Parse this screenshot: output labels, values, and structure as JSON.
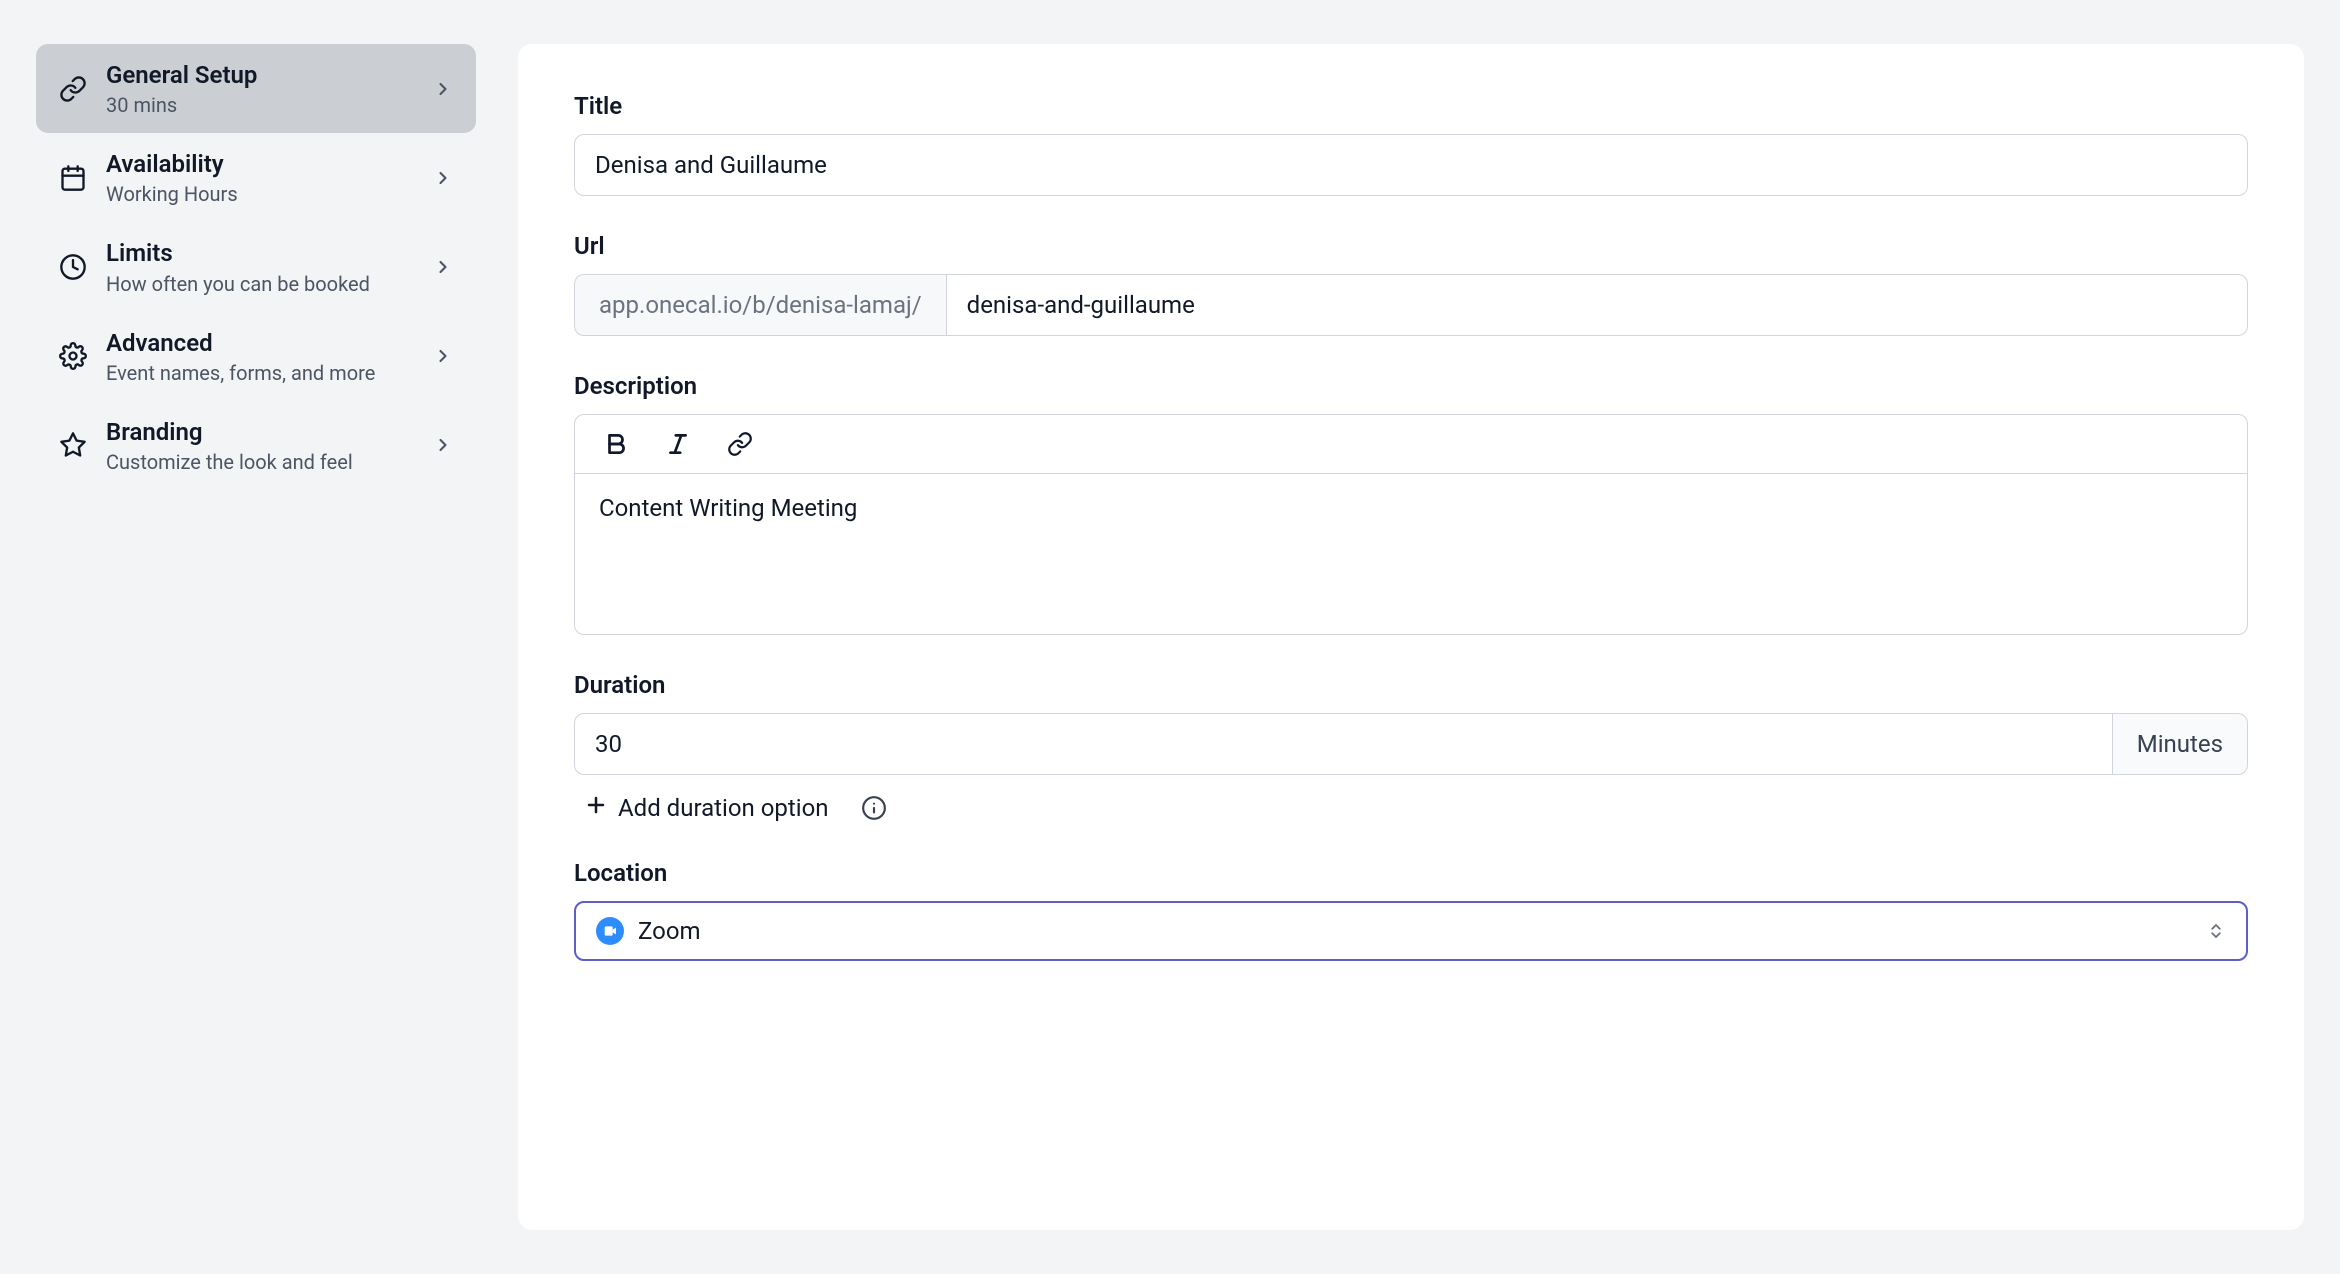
{
  "sidebar": {
    "items": [
      {
        "title": "General Setup",
        "subtitle": "30 mins"
      },
      {
        "title": "Availability",
        "subtitle": "Working Hours"
      },
      {
        "title": "Limits",
        "subtitle": "How often you can be booked"
      },
      {
        "title": "Advanced",
        "subtitle": "Event names, forms, and more"
      },
      {
        "title": "Branding",
        "subtitle": "Customize the look and feel"
      }
    ]
  },
  "form": {
    "title_label": "Title",
    "title_value": "Denisa and Guillaume",
    "url_label": "Url",
    "url_prefix": "app.onecal.io/b/denisa-lamaj/",
    "url_value": "denisa-and-guillaume",
    "description_label": "Description",
    "description_value": "Content Writing Meeting",
    "duration_label": "Duration",
    "duration_value": "30",
    "duration_unit": "Minutes",
    "add_duration_label": "Add duration option",
    "location_label": "Location",
    "location_value": "Zoom"
  }
}
